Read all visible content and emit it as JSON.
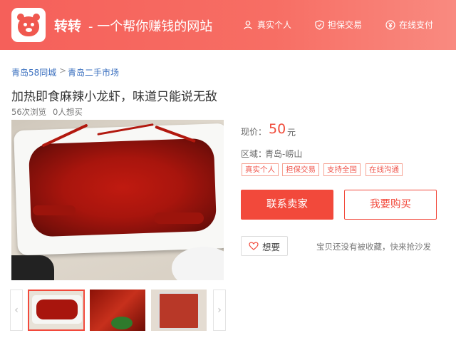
{
  "header": {
    "brand": "转转",
    "slogan": "- 一个帮你赚钱的网站",
    "features": [
      {
        "icon": "user-verify-icon",
        "label": "真实个人"
      },
      {
        "icon": "shield-icon",
        "label": "担保交易"
      },
      {
        "icon": "yen-icon",
        "label": "在线支付"
      }
    ]
  },
  "breadcrumb": {
    "items": [
      "青岛58同城",
      "青岛二手市场"
    ],
    "separator": ">"
  },
  "listing": {
    "title": "加热即食麻辣小龙虾，味道只能说无敌",
    "views": "56次浏览",
    "wants": "0人想买",
    "price_label": "现价：",
    "price": "50",
    "price_unit": "元",
    "area_label": "区域：",
    "area": "青岛-崂山",
    "tags": [
      "真实个人",
      "担保交易",
      "支持全国",
      "在线沟通"
    ]
  },
  "actions": {
    "contact_label": "联系卖家",
    "buy_label": "我要购买",
    "want_label": "想要",
    "favorite_note": "宝贝还没有被收藏，快来抢沙发"
  },
  "thumbnails": {
    "prev": "‹",
    "next": "›",
    "count": 3,
    "selected_index": 0
  },
  "colors": {
    "accent": "#f2493b",
    "header": "#f5605a",
    "link": "#3a6fbf"
  }
}
